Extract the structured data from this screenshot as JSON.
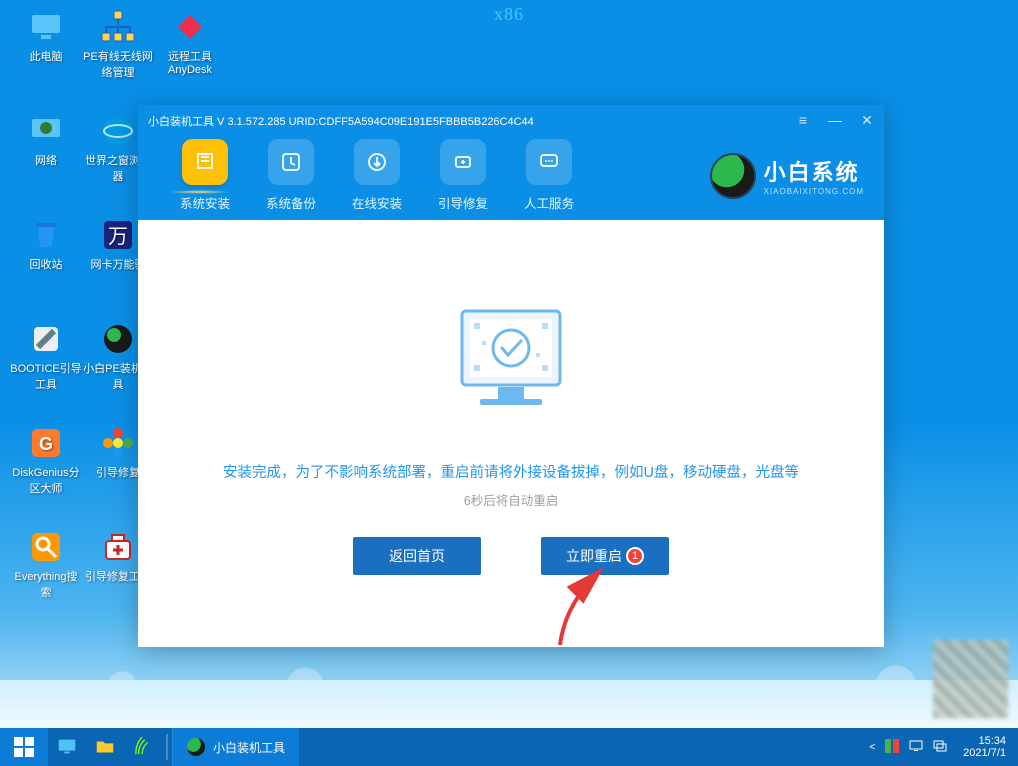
{
  "watermark": "x86",
  "desktop_icons": [
    {
      "label": "此电脑",
      "col": 0,
      "row": 0,
      "kind": "monitor"
    },
    {
      "label": "PE有线无线网络管理",
      "col": 1,
      "row": 0,
      "kind": "net"
    },
    {
      "label": "远程工具AnyDesk",
      "col": 2,
      "row": 0,
      "kind": "anydesk"
    },
    {
      "label": "网络",
      "col": 0,
      "row": 1,
      "kind": "globe"
    },
    {
      "label": "世界之窗浏览器",
      "col": 1,
      "row": 1,
      "kind": "browser"
    },
    {
      "label": "回收站",
      "col": 0,
      "row": 2,
      "kind": "bin"
    },
    {
      "label": "网卡万能驱",
      "col": 1,
      "row": 2,
      "kind": "wan"
    },
    {
      "label": "BOOTICE引导工具",
      "col": 0,
      "row": 3,
      "kind": "bootice"
    },
    {
      "label": "小白PE装机工具",
      "col": 1,
      "row": 3,
      "kind": "xiaobai"
    },
    {
      "label": "DiskGenius分区大师",
      "col": 0,
      "row": 4,
      "kind": "dg"
    },
    {
      "label": "引导修复",
      "col": 1,
      "row": 4,
      "kind": "flower"
    },
    {
      "label": "Everything搜索",
      "col": 0,
      "row": 5,
      "kind": "search"
    },
    {
      "label": "引导修复工具",
      "col": 1,
      "row": 5,
      "kind": "medkit"
    }
  ],
  "window": {
    "title": "小白装机工具 V 3.1.572.285 URID:CDFF5A594C09E191E5FBBB5B226C4C44",
    "tabs": [
      {
        "label": "系统安装",
        "icon": "install"
      },
      {
        "label": "系统备份",
        "icon": "backup"
      },
      {
        "label": "在线安装",
        "icon": "online"
      },
      {
        "label": "引导修复",
        "icon": "repair"
      },
      {
        "label": "人工服务",
        "icon": "chat"
      }
    ],
    "brand": {
      "cn": "小白系统",
      "en": "XIAOBAIXITONG.COM"
    },
    "message": "安装完成，为了不影响系统部署，重启前请将外接设备拔掉，例如U盘，移动硬盘，光盘等",
    "sub": "6秒后将自动重启",
    "btn_back": "返回首页",
    "btn_restart": "立即重启",
    "badge": "1"
  },
  "taskbar": {
    "task_label": "小白装机工具",
    "clock_time": "15:34",
    "clock_date": "2021/7/1"
  }
}
